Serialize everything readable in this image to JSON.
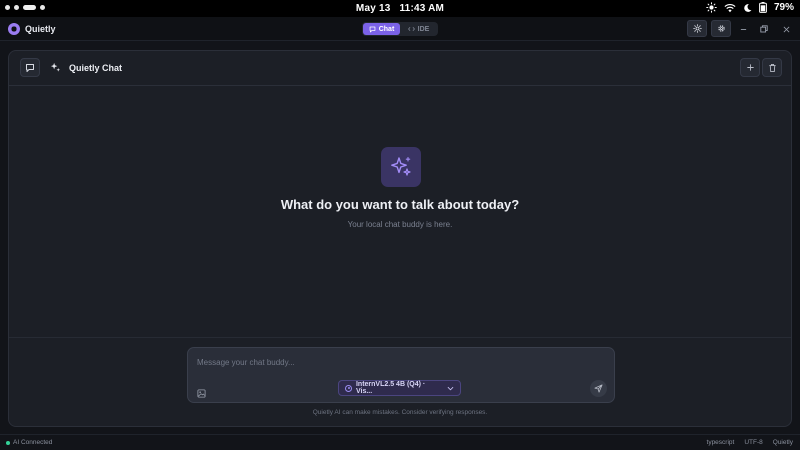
{
  "system_bar": {
    "date": "May 13",
    "time": "11:43 AM",
    "battery": "79%",
    "icons": [
      "brightness-icon",
      "wifi-icon",
      "moon-icon",
      "battery-icon"
    ]
  },
  "titlebar": {
    "app_name": "Quietly",
    "tabs": [
      {
        "label": "Chat",
        "icon": "chat-bubble-icon",
        "active": true
      },
      {
        "label": "IDE",
        "icon": "code-icon",
        "active": false
      }
    ],
    "buttons": [
      "theme-toggle-icon",
      "settings-gear-icon"
    ],
    "window_controls": [
      "minimize",
      "restore",
      "close"
    ]
  },
  "header": {
    "title": "Quietly Chat",
    "buttons": [
      "chat-history-icon",
      "new-chat-icon",
      "delete-chat-icon"
    ]
  },
  "hero": {
    "title": "What do you want to talk about today?",
    "subtitle": "Your local chat buddy is here."
  },
  "composer": {
    "placeholder": "Message your chat buddy...",
    "value": "",
    "model_label": "InternVL2.5 4B (Q4) · Vis..."
  },
  "disclaimer": "Quietly AI can make mistakes. Consider verifying responses.",
  "status_bar": {
    "connection": "AI Connected",
    "language": "typescript",
    "encoding": "UTF-8",
    "app": "Quietly"
  },
  "colors": {
    "accent": "#7b62e8",
    "background": "#121419",
    "card": "#1c1f26",
    "status_ok": "#34d399"
  }
}
